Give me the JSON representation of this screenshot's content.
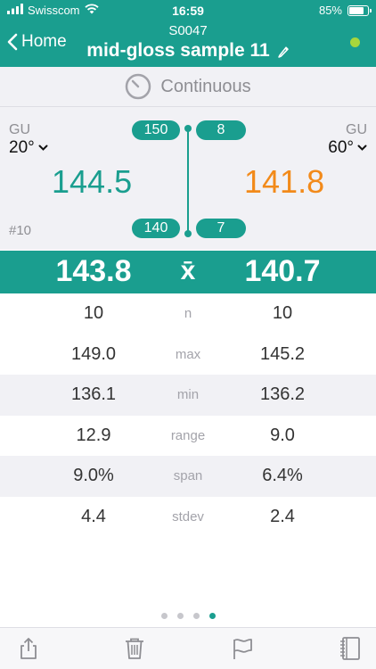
{
  "status_bar": {
    "carrier": "Swisscom",
    "time": "16:59",
    "battery_text": "85%",
    "battery_level": 0.85
  },
  "nav": {
    "back_label": "Home",
    "sample_id": "S0047",
    "title": "mid-gloss sample 11",
    "status_color": "#a7d63c"
  },
  "mode": {
    "label": "Continuous"
  },
  "readings": {
    "left": {
      "unit": "GU",
      "angle": "20°",
      "value": "144.5",
      "color": "#1a9e8f"
    },
    "right": {
      "unit": "GU",
      "angle": "60°",
      "value": "141.8",
      "color": "#f28a1a"
    },
    "counter": "#10",
    "range_top_left": "150",
    "range_top_right": "8",
    "range_bottom_left": "140",
    "range_bottom_right": "7"
  },
  "mean": {
    "left": "143.8",
    "symbol": "x̄",
    "right": "140.7"
  },
  "stats": [
    {
      "left": "10",
      "label": "n",
      "right": "10"
    },
    {
      "left": "149.0",
      "label": "max",
      "right": "145.2"
    },
    {
      "left": "136.1",
      "label": "min",
      "right": "136.2"
    },
    {
      "left": "12.9",
      "label": "range",
      "right": "9.0"
    },
    {
      "left": "9.0%",
      "label": "span",
      "right": "6.4%"
    },
    {
      "left": "4.4",
      "label": "stdev",
      "right": "2.4"
    }
  ],
  "pager": {
    "count": 4,
    "active_index": 3
  },
  "toolbar": {
    "icons": [
      "share-icon",
      "trash-icon",
      "flag-icon",
      "notebook-icon"
    ]
  },
  "colors": {
    "accent": "#1a9e8f",
    "orange": "#f28a1a"
  }
}
